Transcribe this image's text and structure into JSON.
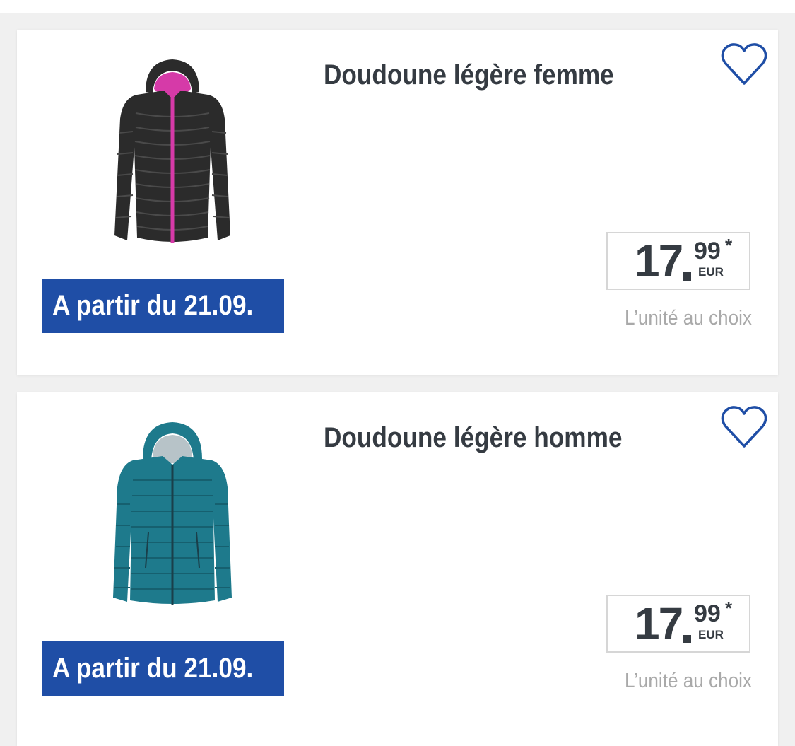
{
  "products": [
    {
      "title": "Doudoune légère femme",
      "price_integer": "17",
      "price_decimal": "99",
      "price_asterisk": "*",
      "currency": "EUR",
      "unit_note": "L’unité au choix",
      "availability": "A partir du 21.09.",
      "image_icon": "black-jacket-with-pink-zipper-icon"
    },
    {
      "title": "Doudoune légère homme",
      "price_integer": "17",
      "price_decimal": "99",
      "price_asterisk": "*",
      "currency": "EUR",
      "unit_note": "L’unité au choix",
      "availability": "A partir du 21.09.",
      "image_icon": "teal-hooded-jacket-icon"
    }
  ],
  "colors": {
    "badge_bg": "#1f4ea6",
    "text_dark": "#353b42",
    "text_muted": "#a9a9a9",
    "heart_outline": "#1f4ea6",
    "jacket_women": "#2b2b2b",
    "jacket_women_zip": "#d63aa8",
    "jacket_men": "#1e7a8c"
  }
}
